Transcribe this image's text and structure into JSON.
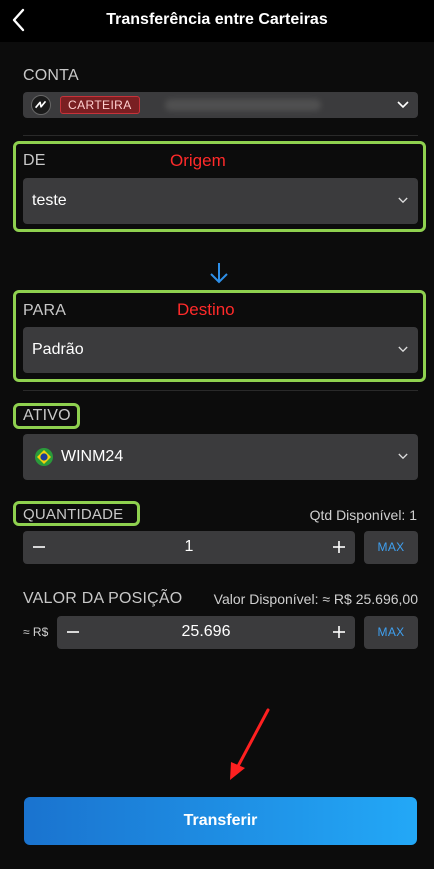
{
  "header": {
    "title": "Transferência entre Carteiras"
  },
  "conta": {
    "label": "CONTA",
    "badge": "CARTEIRA"
  },
  "de": {
    "label": "DE",
    "annotation": "Origem",
    "value": "teste"
  },
  "para": {
    "label": "PARA",
    "annotation": "Destino",
    "value": "Padrão"
  },
  "ativo": {
    "label": "ATIVO",
    "value": "WINM24"
  },
  "quantidade": {
    "label": "QUANTIDADE",
    "available": "Qtd Disponível: 1",
    "value": "1",
    "max_label": "MAX"
  },
  "valor": {
    "label": "VALOR DA POSIÇÃO",
    "available": "Valor Disponível: ≈ R$ 25.696,00",
    "currency_prefix": "≈ R$",
    "value": "25.696",
    "max_label": "MAX"
  },
  "submit": {
    "label": "Transferir"
  },
  "colors": {
    "accent": "#23a8f7",
    "highlight": "#8fd14f",
    "annotation": "#ff2a2a",
    "badge": "#7a1f22"
  }
}
